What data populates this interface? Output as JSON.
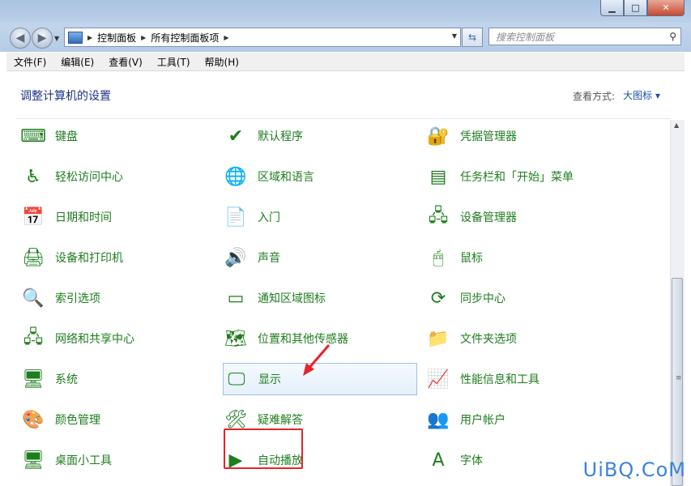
{
  "window": {
    "controls": {
      "minimize": "▁",
      "maximize": "□",
      "close": "✕"
    }
  },
  "navbar": {
    "back": "◀",
    "forward": "▶",
    "breadcrumb": [
      "控制面板",
      "所有控制面板项"
    ],
    "search_placeholder": "搜索控制面板"
  },
  "menu": [
    "文件(F)",
    "编辑(E)",
    "查看(V)",
    "工具(T)",
    "帮助(H)"
  ],
  "content": {
    "heading": "调整计算机的设置",
    "view_label": "查看方式:",
    "view_value": "大图标 ▾"
  },
  "items": [
    {
      "label": "键盘",
      "icon": "keyboard-icon",
      "glyph": "⌨"
    },
    {
      "label": "默认程序",
      "icon": "default-programs-icon",
      "glyph": "✔"
    },
    {
      "label": "凭据管理器",
      "icon": "credential-manager-icon",
      "glyph": "🔐"
    },
    {
      "label": "轻松访问中心",
      "icon": "ease-of-access-icon",
      "glyph": "♿"
    },
    {
      "label": "区域和语言",
      "icon": "region-language-icon",
      "glyph": "🌐"
    },
    {
      "label": "任务栏和「开始」菜单",
      "icon": "taskbar-icon",
      "glyph": "▤"
    },
    {
      "label": "日期和时间",
      "icon": "date-time-icon",
      "glyph": "📅"
    },
    {
      "label": "入门",
      "icon": "getting-started-icon",
      "glyph": "📄"
    },
    {
      "label": "设备管理器",
      "icon": "device-manager-icon",
      "glyph": "🖧"
    },
    {
      "label": "设备和打印机",
      "icon": "printer-icon",
      "glyph": "🖨"
    },
    {
      "label": "声音",
      "icon": "sound-icon",
      "glyph": "🔊"
    },
    {
      "label": "鼠标",
      "icon": "mouse-icon",
      "glyph": "🖱"
    },
    {
      "label": "索引选项",
      "icon": "indexing-icon",
      "glyph": "🔍"
    },
    {
      "label": "通知区域图标",
      "icon": "notification-area-icon",
      "glyph": "▭"
    },
    {
      "label": "同步中心",
      "icon": "sync-center-icon",
      "glyph": "⟳"
    },
    {
      "label": "网络和共享中心",
      "icon": "network-icon",
      "glyph": "🖧"
    },
    {
      "label": "位置和其他传感器",
      "icon": "location-sensor-icon",
      "glyph": "🗺"
    },
    {
      "label": "文件夹选项",
      "icon": "folder-options-icon",
      "glyph": "📁"
    },
    {
      "label": "系统",
      "icon": "system-icon",
      "glyph": "🖥"
    },
    {
      "label": "显示",
      "icon": "display-icon",
      "glyph": "🖵"
    },
    {
      "label": "性能信息和工具",
      "icon": "performance-icon",
      "glyph": "📈"
    },
    {
      "label": "颜色管理",
      "icon": "color-management-icon",
      "glyph": "🎨"
    },
    {
      "label": "疑难解答",
      "icon": "troubleshooting-icon",
      "glyph": "🛠"
    },
    {
      "label": "用户帐户",
      "icon": "user-accounts-icon",
      "glyph": "👥"
    },
    {
      "label": "桌面小工具",
      "icon": "desktop-gadgets-icon",
      "glyph": "🖥"
    },
    {
      "label": "自动播放",
      "icon": "autoplay-icon",
      "glyph": "▶"
    },
    {
      "label": "字体",
      "icon": "fonts-icon",
      "glyph": "A"
    }
  ],
  "watermark": "UiBQ.CoM",
  "colors": {
    "link_green": "#1e7d1e",
    "heading_blue": "#1e3287",
    "highlight_red": "#e8232a"
  }
}
